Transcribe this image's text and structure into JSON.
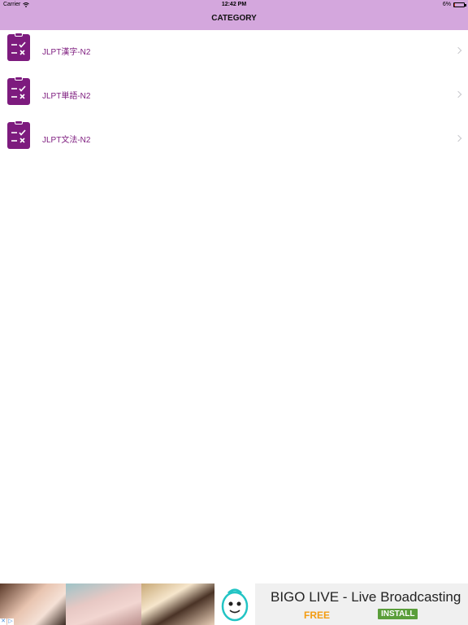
{
  "status": {
    "carrier": "Carrier",
    "time": "12:42 PM",
    "battery": "6%",
    "battery_level": 0.06
  },
  "nav": {
    "title": "CATEGORY"
  },
  "list": {
    "items": [
      {
        "label": "JLPT漢字-N2",
        "icon": "checklist-icon"
      },
      {
        "label": "JLPT単語-N2",
        "icon": "checklist-icon"
      },
      {
        "label": "JLPT文法-N2",
        "icon": "checklist-icon"
      }
    ]
  },
  "ad": {
    "title": "BIGO LIVE - Live Broadcasting",
    "free_label": "FREE",
    "install_label": "INSTALL",
    "icon": "bigo-mascot-icon",
    "choices_icons": [
      "close-icon",
      "adchoices-icon"
    ]
  },
  "colors": {
    "header_bg": "#d4a7dd",
    "accent": "#7d1b7e",
    "free": "#f39c12",
    "install_bg": "#5a9e3a"
  }
}
